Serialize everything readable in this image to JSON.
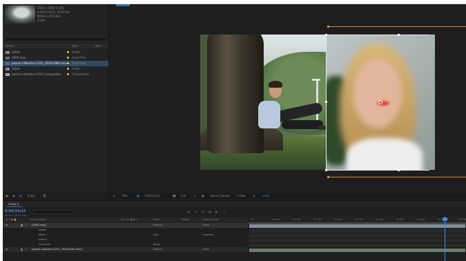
{
  "project": {
    "preview_info": [
      "1920 x 1080 (1.00)",
      "Δ 0;00;14;22, 29.97 fps",
      "Millions of Colors",
      "H.264"
    ],
    "header": {
      "name": "Name",
      "type": "Type",
      "size": "Size"
    },
    "items": [
      {
        "name": "Solids",
        "type": "Folder",
        "label_color": "#e0c84a",
        "kind": "folder"
      },
      {
        "name": "2000.mov",
        "type": "QuickTime",
        "label_color": "#e0c84a",
        "kind": "media"
      },
      {
        "name": "pexels-cottonbro-5331_1920x1080.mov",
        "type": "QuickTime",
        "label_color": "#e0c84a",
        "kind": "media",
        "selected": true
      },
      {
        "name": "Solids",
        "type": "Folder",
        "label_color": "#e0c84a",
        "kind": "folder"
      },
      {
        "name": "pexels-cottonbro-5331 Composition",
        "type": "Composition",
        "label_color": "#e0c84a",
        "kind": "comp"
      }
    ],
    "footer": {
      "bpc": "8 bpc"
    }
  },
  "viewer": {
    "zoom": "50%",
    "resolution": "Full",
    "camera": "Active Camera",
    "views": "1 View",
    "exposure": "+0.0",
    "timecode": "0;00;14;22"
  },
  "timeline": {
    "comp_tab": "Comp 1",
    "current_time": "0;00;14;22",
    "fps_info": "00442 (29.97 fps)",
    "columns": {
      "source_name": "Source Name",
      "mode": "Mode",
      "trkmat": "TrkMat",
      "parent": "Parent & Link"
    },
    "layers": [
      {
        "num": "1",
        "name": "[2000.mov]",
        "mode": "Normal",
        "parent": "None",
        "color": "#7a8f9a"
      },
      {
        "num": "",
        "name": "Masks",
        "mode": "",
        "parent": "",
        "color": ""
      },
      {
        "num": "",
        "name": "Mask 1",
        "mode": "Add",
        "parent": "Inverted",
        "color": ""
      },
      {
        "num": "",
        "name": "Effects",
        "mode": "",
        "parent": "",
        "color": ""
      },
      {
        "num": "",
        "name": "Transform",
        "mode": "Reset",
        "parent": "",
        "color": ""
      },
      {
        "num": "2",
        "name": "[pexels-cottonbro-5331_1920x1080.mov]",
        "mode": "Normal",
        "parent": "None",
        "color": "#6b7f6a"
      }
    ],
    "ruler_ticks": [
      "0f",
      "00:15f",
      "01:00f",
      "01:15f",
      "02:00f",
      "02:15f",
      "03:00f",
      "03:15f",
      "04:00f",
      "04:15f",
      "05:00f"
    ]
  },
  "colors": {
    "accent": "#3a8fe8",
    "selection": "#2f4a63",
    "background": "#1e1e1e"
  }
}
